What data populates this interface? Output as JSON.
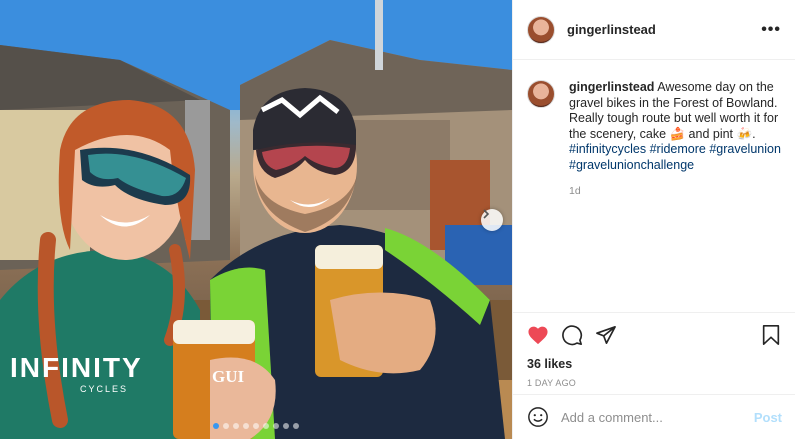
{
  "post": {
    "username": "gingerlinstead",
    "caption": {
      "text": "Awesome day on the gravel bikes in the Forest of Bowland. Really tough route but well worth it for the scenery, cake 🍰 and pint 🍻.",
      "hashtags": "#infinitycycles #ridemore #gravelunion #gravelunionchallenge",
      "age": "1d"
    },
    "likes": "36 likes",
    "posted_ago": "1 DAY AGO",
    "comment_placeholder": "Add a comment...",
    "post_label": "Post",
    "more_label": "•••",
    "photo": {
      "jersey_text": "INFINITY",
      "jersey_sub": "CYCLES",
      "glass_text": "GUI"
    },
    "carousel": {
      "count": 9,
      "active": 1
    }
  },
  "colors": {
    "like": "#ed4956",
    "link": "#00376b",
    "post_disabled": "#b2dffc",
    "muted": "#8e8e8e"
  }
}
